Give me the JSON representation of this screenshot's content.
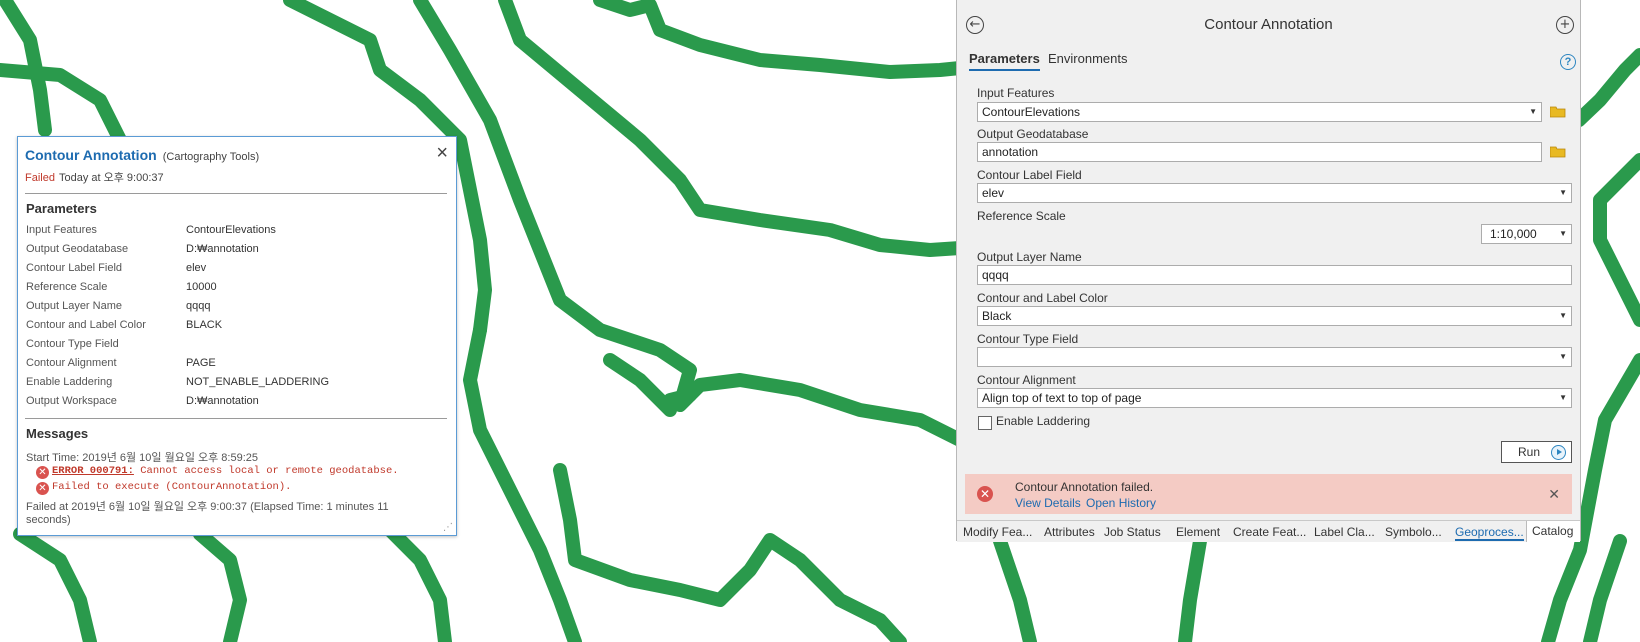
{
  "popup": {
    "title": "Contour Annotation",
    "subtitle": "(Cartography Tools)",
    "status": "Failed",
    "status_time": "Today at 오후 9:00:37",
    "params_header": "Parameters",
    "params": [
      {
        "key": "Input Features",
        "value": "ContourElevations"
      },
      {
        "key": "Output Geodatabase",
        "value": "D:₩annotation"
      },
      {
        "key": "Contour Label Field",
        "value": "elev"
      },
      {
        "key": "Reference Scale",
        "value": "10000"
      },
      {
        "key": "Output Layer Name",
        "value": "qqqq"
      },
      {
        "key": "Contour and Label Color",
        "value": "BLACK"
      },
      {
        "key": "Contour Type Field",
        "value": ""
      },
      {
        "key": "Contour Alignment",
        "value": "PAGE"
      },
      {
        "key": "Enable Laddering",
        "value": "NOT_ENABLE_LADDERING"
      },
      {
        "key": "Output Workspace",
        "value": "D:₩annotation"
      }
    ],
    "messages_header": "Messages",
    "start_time": "Start Time: 2019년 6월 10일 월요일 오후 8:59:25",
    "error_code": "ERROR 000791:",
    "error_text": " Cannot access local or remote geodatabse.",
    "error2": "Failed to execute (ContourAnnotation).",
    "failed_at": "Failed at 2019년 6월 10일 월요일 오후 9:00:37 (Elapsed Time: 1 minutes 11 seconds)"
  },
  "gp": {
    "title": "Contour Annotation",
    "tabs": {
      "parameters": "Parameters",
      "environments": "Environments"
    },
    "fields": {
      "input_features": {
        "label": "Input Features",
        "value": "ContourElevations"
      },
      "output_gdb": {
        "label": "Output Geodatabase",
        "value": "annotation"
      },
      "label_field": {
        "label": "Contour Label Field",
        "value": "elev"
      },
      "ref_scale": {
        "label": "Reference Scale",
        "value": "1:10,000"
      },
      "layer_name": {
        "label": "Output Layer Name",
        "value": "qqqq"
      },
      "color": {
        "label": "Contour and Label Color",
        "value": "Black"
      },
      "type_field": {
        "label": "Contour Type Field",
        "value": ""
      },
      "alignment": {
        "label": "Contour Alignment",
        "value": "Align top of text  to top of page"
      }
    },
    "laddering_label": "Enable Laddering",
    "laddering_checked": false,
    "run_label": "Run",
    "banner": {
      "text": "Contour Annotation failed.",
      "view_details": "View Details",
      "open_history": "Open History"
    },
    "bottom_tabs": [
      "Modify Fea...",
      "Attributes",
      "Job Status",
      "Element",
      "Create Feat...",
      "Label Cla...",
      "Symbolo...",
      "Geoproces...",
      "Catalog"
    ],
    "active_bottom_tab": "Geoproces..."
  },
  "colors": {
    "contour": "#2a9a4c",
    "accent": "#1d6bb0",
    "error": "#c0392b",
    "banner": "#f4cbc4"
  }
}
